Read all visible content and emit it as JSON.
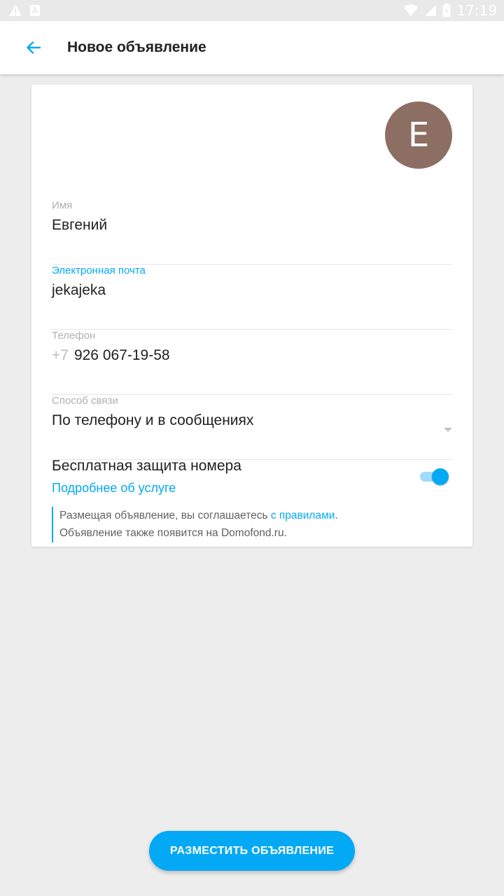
{
  "status_bar": {
    "time": "17:19",
    "icons": [
      "warning-icon",
      "a-notification-icon",
      "wifi-icon",
      "signal-icon",
      "battery-icon"
    ]
  },
  "appbar": {
    "title": "Новое объявление",
    "back_icon": "arrow-left-icon"
  },
  "profile": {
    "avatar_letter": "E",
    "avatar_color": "#8d6e63"
  },
  "fields": {
    "name": {
      "label": "Имя",
      "value": "Евгений"
    },
    "email": {
      "label": "Электронная почта",
      "value": "jekajeka"
    },
    "phone": {
      "label": "Телефон",
      "prefix": "+7",
      "value": "926 067-19-58"
    },
    "contact": {
      "label": "Способ связи",
      "value": "По телефону и в сообщениях"
    }
  },
  "protection": {
    "title": "Бесплатная защита номера",
    "link": "Подробнее об услуге",
    "enabled": true
  },
  "notice": {
    "text_before": "Размещая объявление, вы соглашаетесь ",
    "link": "с правилами",
    "text_after": ".",
    "line2": "Объявление также появится на Domofond.ru."
  },
  "actions": {
    "post_label": "РАЗМЕСТИТЬ ОБЪЯВЛЕНИЕ"
  },
  "colors": {
    "accent": "#03a9f4",
    "background": "#ededed"
  }
}
